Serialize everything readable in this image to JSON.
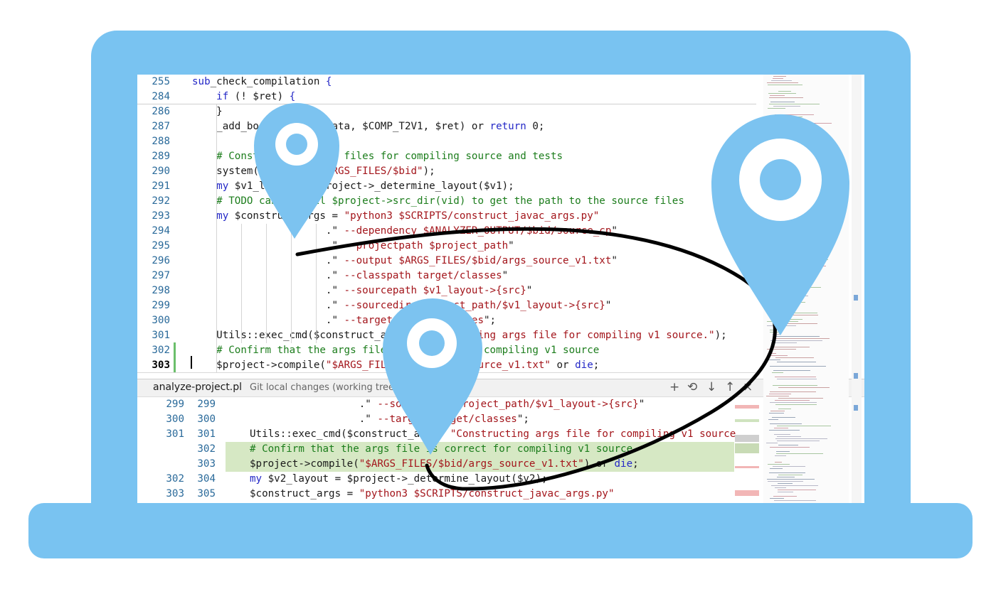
{
  "editor": {
    "lines": [
      {
        "n": "255",
        "tokens": [
          [
            "kw",
            "sub"
          ],
          [
            "",
            "_check_compilation "
          ],
          [
            "kw",
            "{"
          ]
        ]
      },
      {
        "n": "284",
        "tokens": [
          [
            "",
            "    "
          ],
          [
            "kw",
            "if"
          ],
          [
            "",
            " (! $ret) "
          ],
          [
            "kw",
            "{"
          ]
        ]
      },
      {
        "n": "286",
        "tokens": [
          [
            "",
            "    }"
          ]
        ]
      },
      {
        "n": "287",
        "tokens": [
          [
            "",
            "    _add_bool_result($data, $COMP_T2V1, $ret) or "
          ],
          [
            "kw",
            "return"
          ],
          [
            "",
            " 0;"
          ]
        ]
      },
      {
        "n": "288",
        "tokens": []
      },
      {
        "n": "289",
        "tokens": [
          [
            "cmt",
            "    # Construct the args files for compiling source and tests"
          ]
        ]
      },
      {
        "n": "290",
        "tokens": [
          [
            "",
            "    system("
          ],
          [
            "str",
            "\"mkdir -p $ARGS_FILES/$bid\""
          ],
          [
            "",
            ");"
          ]
        ]
      },
      {
        "n": "291",
        "tokens": [
          [
            "",
            "    "
          ],
          [
            "kw",
            "my"
          ],
          [
            "",
            " $v1_layout = $project->_determine_layout($v1);"
          ]
        ]
      },
      {
        "n": "292",
        "tokens": [
          [
            "cmt",
            "    # TODO can we call $project->src_dir(vid) to get the path to the source files"
          ]
        ]
      },
      {
        "n": "293",
        "tokens": [
          [
            "",
            "    "
          ],
          [
            "kw",
            "my"
          ],
          [
            "",
            " $construct_args = "
          ],
          [
            "str",
            "\"python3 $SCRIPTS/construct_javac_args.py\""
          ]
        ]
      },
      {
        "n": "294",
        "tokens": [
          [
            "",
            "                      .\""
          ],
          [
            "str",
            " --dependency $ANALYZER_OUTPUT/$bid/source_cp"
          ],
          [
            "",
            "\""
          ]
        ]
      },
      {
        "n": "295",
        "tokens": [
          [
            "",
            "                      .\""
          ],
          [
            "str",
            " --projectpath $project_path"
          ],
          [
            "",
            "\""
          ]
        ]
      },
      {
        "n": "296",
        "tokens": [
          [
            "",
            "                      .\""
          ],
          [
            "str",
            " --output $ARGS_FILES/$bid/args_source_v1.txt"
          ],
          [
            "",
            "\""
          ]
        ]
      },
      {
        "n": "297",
        "tokens": [
          [
            "",
            "                      .\""
          ],
          [
            "str",
            " --classpath target/classes"
          ],
          [
            "",
            "\""
          ]
        ]
      },
      {
        "n": "298",
        "tokens": [
          [
            "",
            "                      .\""
          ],
          [
            "str",
            " --sourcepath $v1_layout->{src}"
          ],
          [
            "",
            "\""
          ]
        ]
      },
      {
        "n": "299",
        "tokens": [
          [
            "",
            "                      .\""
          ],
          [
            "str",
            " --sourcedir $project_path/$v1_layout->{src}"
          ],
          [
            "",
            "\""
          ]
        ]
      },
      {
        "n": "300",
        "tokens": [
          [
            "",
            "                      .\""
          ],
          [
            "str",
            " --target target/classes"
          ],
          [
            "",
            "\";"
          ]
        ]
      },
      {
        "n": "301",
        "tokens": [
          [
            "",
            "    Utils::exec_cmd($construct_args, "
          ],
          [
            "str",
            "\"Constructing args file for compiling v1 source.\""
          ],
          [
            "",
            ");"
          ]
        ]
      },
      {
        "n": "302",
        "tokens": [
          [
            "cmt",
            "    # Confirm that the args file is correct for compiling v1 source"
          ]
        ]
      },
      {
        "n": "303",
        "tokens": [
          [
            "",
            "    $project->compile("
          ],
          [
            "str",
            "\"$ARGS_FILES/$bid/args_source_v1.txt\""
          ],
          [
            "",
            " or "
          ],
          [
            "kw",
            "die"
          ],
          [
            "",
            ";"
          ]
        ]
      }
    ]
  },
  "diff_panel": {
    "file_name": "analyze-project.pl",
    "description": "Git local changes (working tree)",
    "toolbar": {
      "add": "+",
      "revert": "⟲",
      "next": "↓",
      "prev": "↑",
      "close": "×"
    },
    "lines": [
      {
        "a": "299",
        "b": "299",
        "added": false,
        "tokens": [
          [
            "",
            "                  .\""
          ],
          [
            "str",
            " --sourcedir $project_path/$v1_layout->{src}"
          ],
          [
            "",
            "\""
          ]
        ]
      },
      {
        "a": "300",
        "b": "300",
        "added": false,
        "tokens": [
          [
            "",
            "                  .\""
          ],
          [
            "str",
            " --target target/classes"
          ],
          [
            "",
            "\";"
          ]
        ]
      },
      {
        "a": "301",
        "b": "301",
        "added": false,
        "tokens": [
          [
            "",
            "Utils::exec_cmd($construct_args, "
          ],
          [
            "str",
            "\"Constructing args file for compiling v1 source."
          ]
        ]
      },
      {
        "a": "",
        "b": "302",
        "added": true,
        "tokens": [
          [
            "cmt",
            "# Confirm that the args file is correct for compiling v1 source"
          ]
        ]
      },
      {
        "a": "",
        "b": "303",
        "added": true,
        "tokens": [
          [
            "",
            "$project->compile("
          ],
          [
            "str",
            "\"$ARGS_FILES/$bid/args_source_v1.txt\""
          ],
          [
            "",
            ") or "
          ],
          [
            "kw",
            "die"
          ],
          [
            "",
            ";"
          ]
        ]
      },
      {
        "a": "302",
        "b": "304",
        "added": false,
        "tokens": [
          [
            "kw",
            "my"
          ],
          [
            "",
            " $v2_layout = $project->_determine_layout($v2);"
          ]
        ]
      },
      {
        "a": "303",
        "b": "305",
        "added": false,
        "tokens": [
          [
            "",
            "$construct_args = "
          ],
          [
            "str",
            "\"python3 $SCRIPTS/construct_javac_args.py\""
          ]
        ]
      }
    ]
  },
  "colors": {
    "laptop": "#79c3f1",
    "pin": "#7cc3f0",
    "keyword": "#2428c7",
    "string": "#a3151b",
    "comment": "#1c7d1c",
    "added_bg": "#d6e8c4"
  },
  "icons": [
    "map-pin-icon",
    "map-pin-icon",
    "map-pin-icon",
    "eye-curve"
  ]
}
